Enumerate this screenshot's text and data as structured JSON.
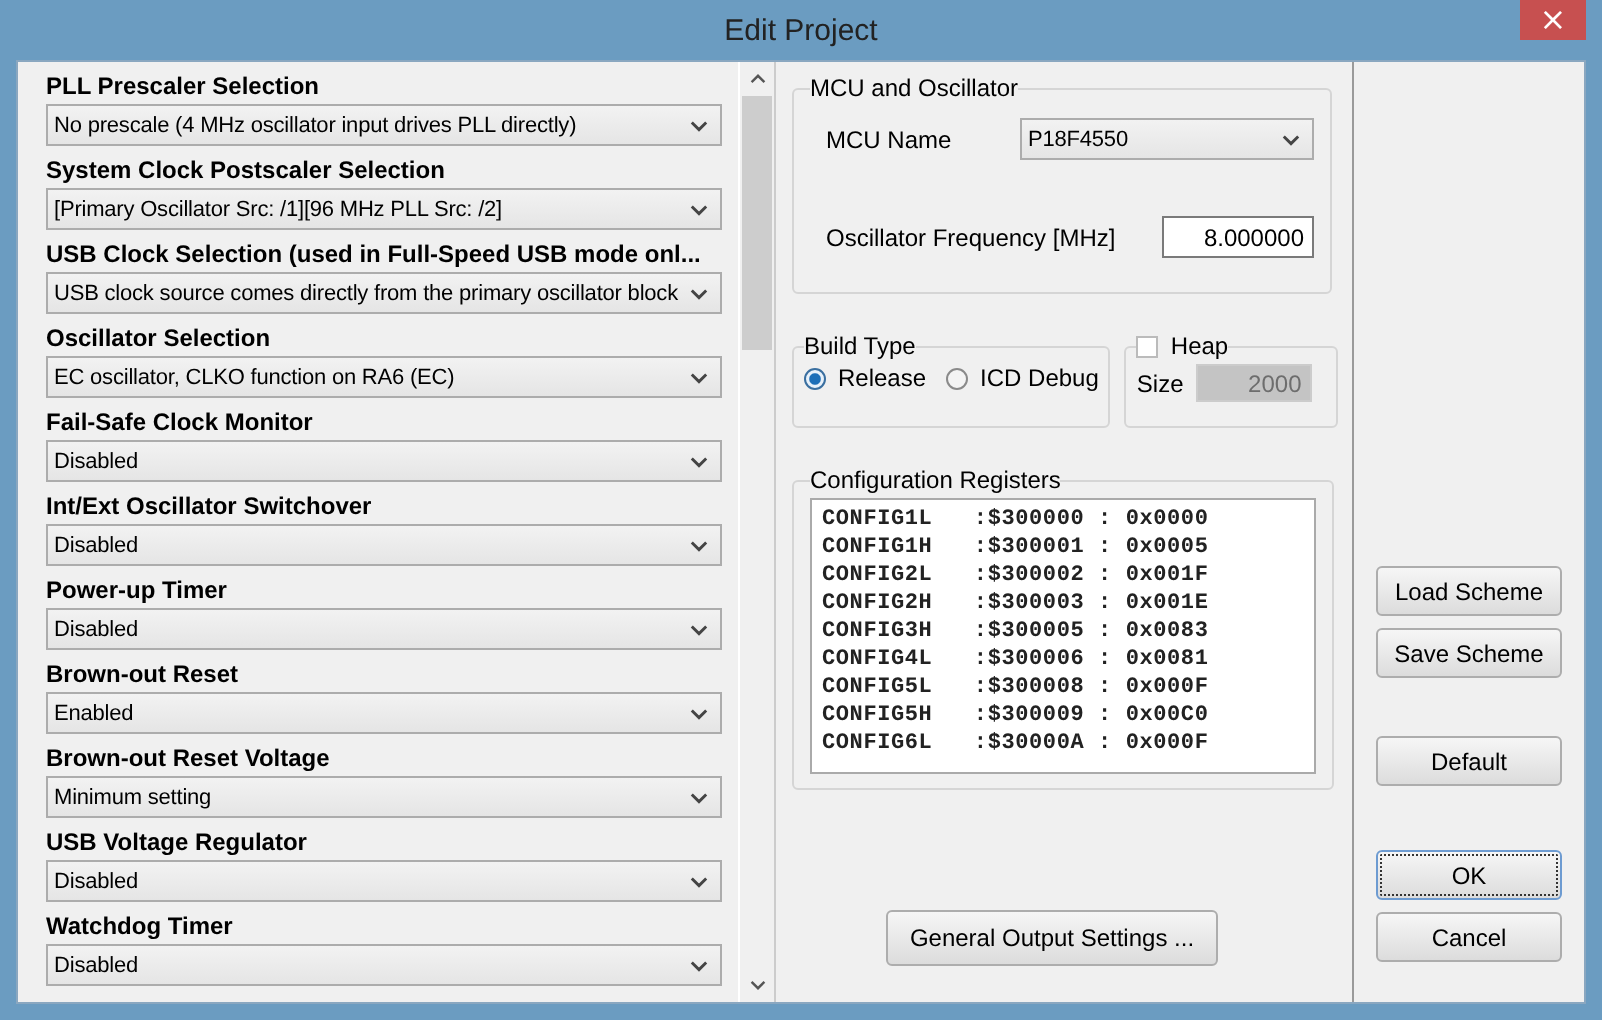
{
  "window": {
    "title": "Edit Project",
    "close": "×"
  },
  "settings": [
    {
      "label": "PLL Prescaler Selection",
      "value": "No prescale (4 MHz oscillator input drives PLL directly)"
    },
    {
      "label": "System Clock Postscaler Selection",
      "value": "[Primary Oscillator Src: /1][96 MHz PLL Src: /2]"
    },
    {
      "label": "USB Clock Selection (used in Full-Speed USB mode onl...",
      "value": "USB clock source comes directly from the primary oscillator block"
    },
    {
      "label": "Oscillator Selection",
      "value": "EC oscillator, CLKO function on RA6 (EC)"
    },
    {
      "label": "Fail-Safe Clock Monitor",
      "value": "Disabled"
    },
    {
      "label": "Int/Ext Oscillator Switchover",
      "value": "Disabled"
    },
    {
      "label": "Power-up Timer",
      "value": "Disabled"
    },
    {
      "label": "Brown-out Reset",
      "value": "Enabled"
    },
    {
      "label": "Brown-out Reset Voltage",
      "value": "Minimum setting"
    },
    {
      "label": "USB Voltage Regulator",
      "value": "Disabled"
    },
    {
      "label": "Watchdog Timer",
      "value": "Disabled"
    }
  ],
  "mcu": {
    "title": "MCU and Oscillator",
    "name_label": "MCU Name",
    "name_value": "P18F4550",
    "freq_label": "Oscillator Frequency [MHz]",
    "freq_value": "8.000000"
  },
  "build_type": {
    "title": "Build Type",
    "options": [
      {
        "label": "Release",
        "selected": true
      },
      {
        "label": "ICD Debug",
        "selected": false
      }
    ]
  },
  "heap": {
    "label": "Heap",
    "checked": false,
    "size_label": "Size",
    "size_value": "2000",
    "disabled": true
  },
  "config_registers": {
    "title": "Configuration Registers",
    "lines": [
      "CONFIG1L   :$300000 : 0x0000",
      "CONFIG1H   :$300001 : 0x0005",
      "CONFIG2L   :$300002 : 0x001F",
      "CONFIG2H   :$300003 : 0x001E",
      "CONFIG3H   :$300005 : 0x0083",
      "CONFIG4L   :$300006 : 0x0081",
      "CONFIG5L   :$300008 : 0x000F",
      "CONFIG5H   :$300009 : 0x00C0",
      "CONFIG6L   :$30000A : 0x000F"
    ]
  },
  "output_button": "General Output Settings ...",
  "buttons": [
    {
      "label": "Load Scheme",
      "kind": "scheme",
      "focused": false
    },
    {
      "label": "Save Scheme",
      "kind": "scheme",
      "focused": false
    },
    {
      "label": "Default",
      "kind": "default",
      "focused": false
    },
    {
      "label": "OK",
      "kind": "confirm",
      "focused": true
    },
    {
      "label": "Cancel",
      "kind": "cancel",
      "focused": false
    }
  ]
}
